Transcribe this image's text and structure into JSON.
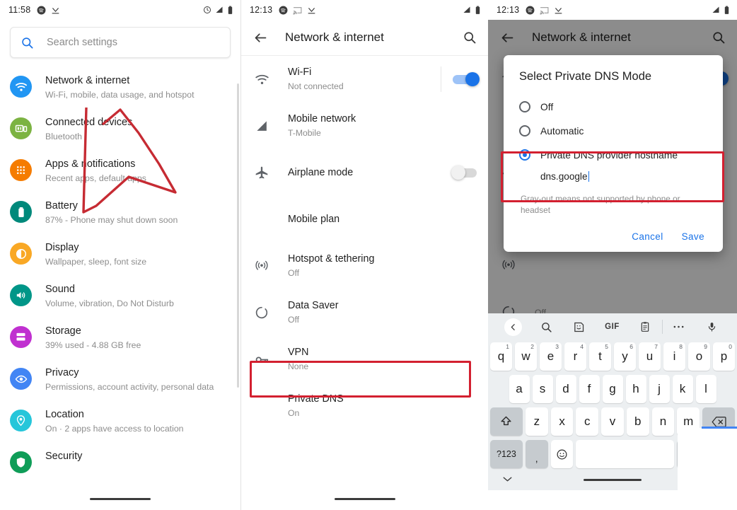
{
  "panel1": {
    "status": {
      "time": "11:58",
      "left_icons": [
        "spotify-icon",
        "download-icon"
      ],
      "right_icons": [
        "alarm-icon",
        "signal-icon",
        "battery-icon"
      ]
    },
    "search": {
      "placeholder": "Search settings",
      "icon": "search-icon"
    },
    "items": [
      {
        "title": "Network & internet",
        "sub": "Wi-Fi, mobile, data usage, and hotspot",
        "icon": "wifi-icon",
        "color": "#2196f3"
      },
      {
        "title": "Connected devices",
        "sub": "Bluetooth",
        "icon": "devices-icon",
        "color": "#7cb342"
      },
      {
        "title": "Apps & notifications",
        "sub": "Recent apps, default apps",
        "icon": "apps-icon",
        "color": "#f57c00"
      },
      {
        "title": "Battery",
        "sub": "87% - Phone may shut down soon",
        "icon": "battery-icon",
        "color": "#00897b"
      },
      {
        "title": "Display",
        "sub": "Wallpaper, sleep, font size",
        "icon": "brightness-icon",
        "color": "#f9a825"
      },
      {
        "title": "Sound",
        "sub": "Volume, vibration, Do Not Disturb",
        "icon": "volume-icon",
        "color": "#009688"
      },
      {
        "title": "Storage",
        "sub": "39% used - 4.88 GB free",
        "icon": "storage-icon",
        "color": "#c030d0"
      },
      {
        "title": "Privacy",
        "sub": "Permissions, account activity, personal data",
        "icon": "privacy-eye-icon",
        "color": "#4285f4"
      },
      {
        "title": "Location",
        "sub": "On · 2 apps have access to location",
        "icon": "location-pin-icon",
        "color": "#26c6da"
      },
      {
        "title": "Security",
        "sub": "",
        "icon": "security-shield-icon",
        "color": "#0f9d58"
      }
    ],
    "annotation": {
      "type": "arrow",
      "color": "#d32030",
      "points_to": "Network & internet"
    }
  },
  "panel2": {
    "status": {
      "time": "12:13",
      "left_icons": [
        "spotify-icon",
        "cast-icon",
        "download-icon"
      ],
      "right_icons": [
        "signal-icon",
        "battery-icon"
      ]
    },
    "appbar": {
      "title": "Network & internet",
      "back_icon": "back-arrow-icon",
      "search_icon": "search-icon"
    },
    "rows": [
      {
        "title": "Wi-Fi",
        "sub": "Not connected",
        "icon": "wifi-icon",
        "toggle": "on"
      },
      {
        "title": "Mobile network",
        "sub": "T-Mobile",
        "icon": "signal-triangle-icon",
        "toggle": null
      },
      {
        "title": "Airplane mode",
        "sub": "",
        "icon": "airplane-icon",
        "toggle": "off"
      },
      {
        "title": "Mobile plan",
        "sub": "",
        "icon": null,
        "toggle": null
      },
      {
        "title": "Hotspot & tethering",
        "sub": "Off",
        "icon": "hotspot-icon",
        "toggle": null
      },
      {
        "title": "Data Saver",
        "sub": "Off",
        "icon": "datasaver-icon",
        "toggle": null
      },
      {
        "title": "VPN",
        "sub": "None",
        "icon": "vpn-key-icon",
        "toggle": null
      },
      {
        "title": "Private DNS",
        "sub": "On",
        "icon": null,
        "toggle": null,
        "highlighted": true
      }
    ],
    "annotation": {
      "type": "box",
      "color": "#d32030",
      "around": "Private DNS"
    }
  },
  "panel3": {
    "status": {
      "time": "12:13",
      "left_icons": [
        "spotify-icon",
        "cast-icon",
        "download-icon"
      ],
      "right_icons": [
        "signal-icon",
        "battery-icon"
      ]
    },
    "appbar": {
      "title": "Network & internet",
      "back_icon": "back-arrow-icon",
      "search_icon": "search-icon"
    },
    "dialog": {
      "title": "Select Private DNS Mode",
      "options": [
        {
          "label": "Off",
          "selected": false
        },
        {
          "label": "Automatic",
          "selected": false
        },
        {
          "label": "Private DNS provider hostname",
          "selected": true
        }
      ],
      "input_value": "dns.google",
      "note": "Gray-out means not supported by phone or headset",
      "cancel_label": "Cancel",
      "save_label": "Save"
    },
    "annotation": {
      "type": "box",
      "color": "#d32030",
      "around": "Private DNS provider hostname + dns.google"
    },
    "keyboard": {
      "toolbar": [
        "back-chevron-icon",
        "search-icon",
        "sticker-icon",
        "GIF",
        "clipboard-icon",
        "more-dots-icon",
        "microphone-icon"
      ],
      "gif_label": "GIF",
      "row1": [
        {
          "k": "q",
          "n": "1"
        },
        {
          "k": "w",
          "n": "2"
        },
        {
          "k": "e",
          "n": "3"
        },
        {
          "k": "r",
          "n": "4"
        },
        {
          "k": "t",
          "n": "5"
        },
        {
          "k": "y",
          "n": "6"
        },
        {
          "k": "u",
          "n": "7"
        },
        {
          "k": "i",
          "n": "8"
        },
        {
          "k": "o",
          "n": "9"
        },
        {
          "k": "p",
          "n": "0"
        }
      ],
      "row2": [
        "a",
        "s",
        "d",
        "f",
        "g",
        "h",
        "j",
        "k",
        "l"
      ],
      "row3": [
        "z",
        "x",
        "c",
        "v",
        "b",
        "n",
        "m"
      ],
      "shift_icon": "shift-up-arrow-icon",
      "backspace_icon": "backspace-icon",
      "symbols_label": "?123",
      "comma_label": ",",
      "emoji_icon": "emoji-smiley-icon",
      "space_label": ""
    }
  }
}
